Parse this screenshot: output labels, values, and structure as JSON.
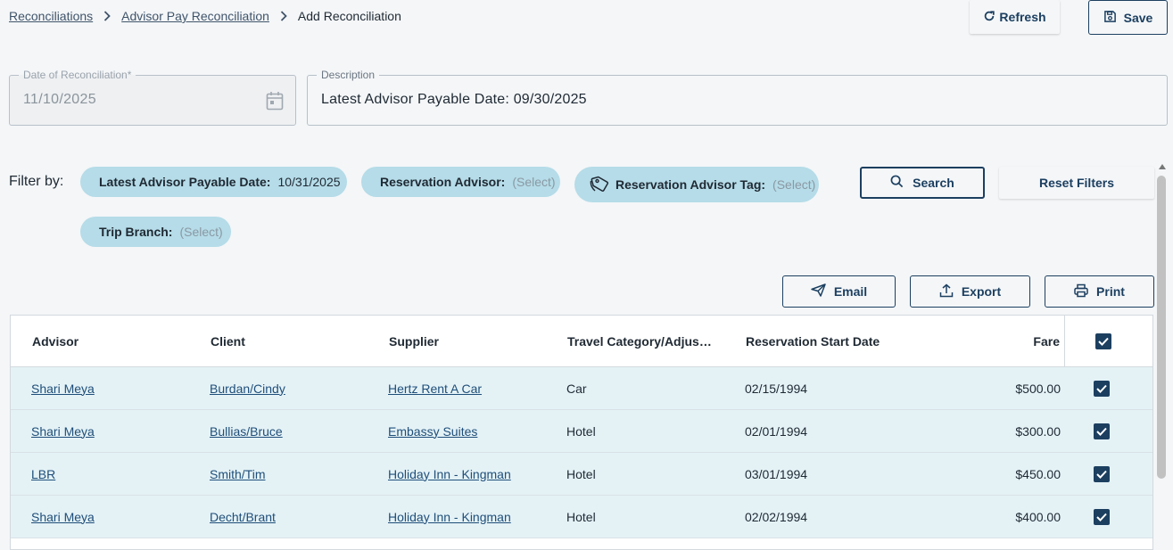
{
  "breadcrumb": {
    "items": [
      "Reconciliations",
      "Advisor Pay Reconciliation"
    ],
    "current": "Add Reconciliation"
  },
  "toolbar": {
    "refresh_label": "Refresh",
    "save_label": "Save"
  },
  "form": {
    "date_label": "Date of Reconciliation*",
    "date_value": "11/10/2025",
    "description_label": "Description",
    "description_value": "Latest Advisor Payable Date: 09/30/2025"
  },
  "filters": {
    "label": "Filter by:",
    "chips": [
      {
        "key": "Latest Advisor Payable Date:",
        "value": "10/31/2025"
      },
      {
        "key": "Reservation Advisor:",
        "value": "(Select)"
      },
      {
        "key": "Reservation Advisor Tag:",
        "value": "(Select)"
      },
      {
        "key": "Trip Branch:",
        "value": "(Select)"
      }
    ],
    "search_label": "Search",
    "reset_label": "Reset Filters"
  },
  "actions": {
    "email_label": "Email",
    "export_label": "Export",
    "print_label": "Print"
  },
  "table": {
    "columns": [
      "Advisor",
      "Client",
      "Supplier",
      "Travel Category/Adjus…",
      "Reservation Start Date",
      "Fare"
    ],
    "header_checked": true,
    "rows": [
      {
        "advisor": "Shari Meya",
        "client": "Burdan/Cindy",
        "supplier": "Hertz Rent A Car",
        "category": "Car",
        "start_date": "02/15/1994",
        "fare": "$500.00",
        "checked": true
      },
      {
        "advisor": "Shari Meya",
        "client": "Bullias/Bruce",
        "supplier": "Embassy Suites",
        "category": "Hotel",
        "start_date": "02/01/1994",
        "fare": "$300.00",
        "checked": true
      },
      {
        "advisor": "LBR",
        "client": "Smith/Tim",
        "supplier": "Holiday Inn - Kingman",
        "category": "Hotel",
        "start_date": "03/01/1994",
        "fare": "$450.00",
        "checked": true
      },
      {
        "advisor": "Shari Meya",
        "client": "Decht/Brant",
        "supplier": "Holiday Inn - Kingman",
        "category": "Hotel",
        "start_date": "02/02/1994",
        "fare": "$400.00",
        "checked": true
      }
    ]
  },
  "colors": {
    "primary": "#1c3f60",
    "chip_bg": "#b5dce8",
    "row_bg": "#e4f2f6",
    "page_bg": "#f4f6f8"
  },
  "icons": {
    "refresh": "refresh-icon",
    "save": "floppy-disk-icon",
    "calendar": "calendar-icon",
    "tag": "tag-icon",
    "search": "search-icon",
    "email": "send-icon",
    "export": "upload-icon",
    "print": "printer-icon",
    "check": "check-icon"
  }
}
